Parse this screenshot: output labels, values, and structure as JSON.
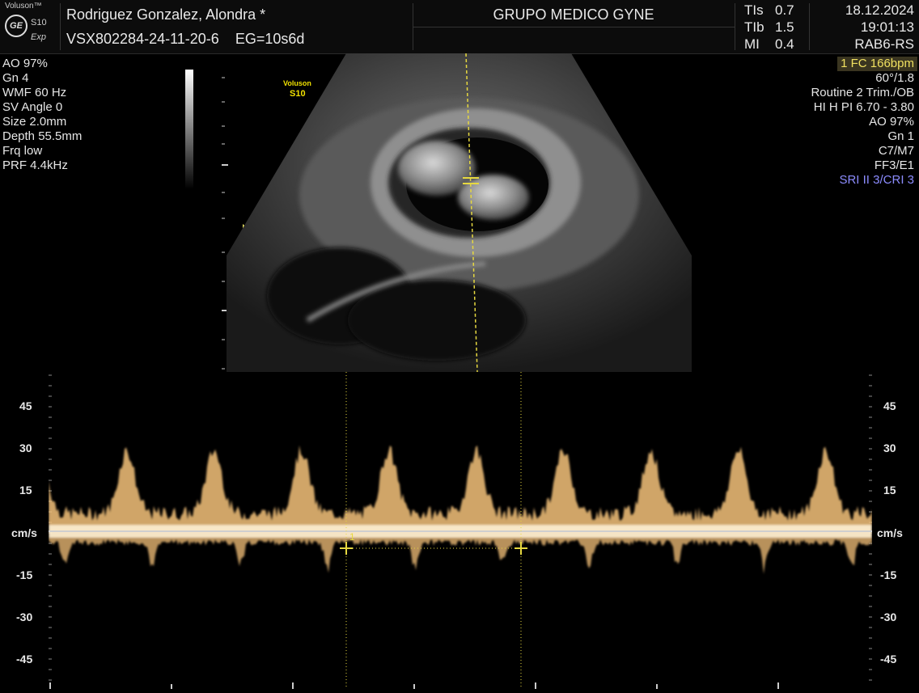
{
  "header": {
    "brand": "Voluson™",
    "model": "S10",
    "mode": "Exp",
    "ge_logo": "GE",
    "patient_name": "Rodriguez Gonzalez, Alondra  *",
    "patient_id": "VSX802284-24-11-20-6",
    "gestational_age": "EG=10s6d",
    "institution": "GRUPO MEDICO GYNE",
    "tis_label": "TIs",
    "tis_value": "0.7",
    "tib_label": "TIb",
    "tib_value": "1.5",
    "mi_label": "MI",
    "mi_value": "0.4",
    "date": "18.12.2024",
    "time": "19:01:13",
    "probe": "RAB6-RS"
  },
  "left_params": [
    "AO 97%",
    "Gn  4",
    "WMF 60 Hz",
    "SV Angle  0",
    "Size  2.0mm",
    "Depth 55.5mm",
    "Frq low",
    "PRF  4.4kHz"
  ],
  "right_params": {
    "measurement": "1  FC 166bpm",
    "lines": [
      "60°/1.8",
      "Routine 2 Trim./OB",
      "HI H PI 6.70 - 3.80",
      "AO 97%",
      "Gn  1",
      "C7/M7",
      "FF3/E1"
    ],
    "sri": "SRI II 3/CRI 3"
  },
  "image_watermark": {
    "line1": "Voluson",
    "line2": "S10"
  },
  "doppler": {
    "unit": "cm/s",
    "ticks": [
      "45",
      "30",
      "15",
      "-15",
      "-30",
      "-45"
    ],
    "caliper_label": "1"
  },
  "colors": {
    "doppler": "#f5c27a",
    "caliper": "#e6d840",
    "sri": "#8c8cff",
    "measure_bg": "#3a3520"
  }
}
